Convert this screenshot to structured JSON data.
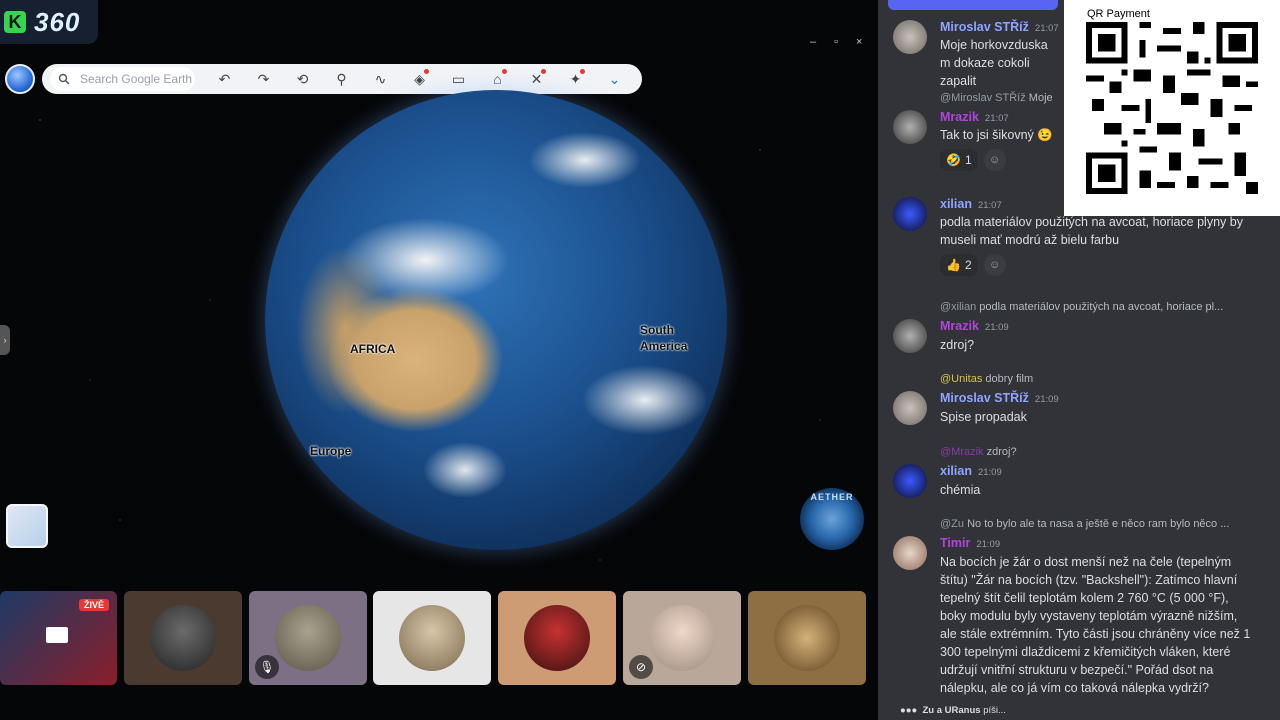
{
  "stream_logo": {
    "letter": "K",
    "number": "360"
  },
  "window_controls": [
    "–",
    "▫",
    "×"
  ],
  "earth": {
    "search_placeholder": "Search Google Earth",
    "labels": {
      "africa": "AFRICA",
      "south_america": "South\nAmerica",
      "europe": "Europe"
    },
    "aether_text": "AETHER"
  },
  "participants": [
    {
      "name": "live-screen",
      "badge": "ŽIVĚ"
    },
    {
      "name": "participant-2"
    },
    {
      "name": "participant-3",
      "muted": true
    },
    {
      "name": "participant-4"
    },
    {
      "name": "participant-5"
    },
    {
      "name": "participant-6",
      "muted": true
    },
    {
      "name": "participant-7"
    }
  ],
  "chat": {
    "banner": "…",
    "qr_label": "QR Payment",
    "messages": [
      {
        "user": "Miroslav STŘíž",
        "time": "21:07",
        "text": "Moje horkovzduska m dokaze cokoli zapalit",
        "user_color": "#8fa4ff"
      },
      {
        "reply_to": "@Miroslav STŘíž",
        "reply_text": "Moje",
        "user": "Mrazik",
        "time": "21:07",
        "text": "Tak to jsi šikovný 😉",
        "user_color": "#b245d9",
        "reactions": [
          {
            "emoji": "🤣",
            "count": "1"
          }
        ]
      },
      {
        "user": "xilian",
        "time": "21:07",
        "text": "podla materiálov použitých na avcoat, horiace plyny by museli mať modrú až bielu farbu",
        "user_color": "#8fa4ff",
        "reactions": [
          {
            "emoji": "👍",
            "count": "2"
          }
        ]
      },
      {
        "reply_to": "@xilian",
        "reply_text": "podla materiálov použitých na avcoat, horiace pl...",
        "user": "Mrazik",
        "time": "21:09",
        "text": "zdroj?",
        "user_color": "#b245d9"
      },
      {
        "reply_to": "@Unitas",
        "reply_text": "dobry film",
        "user": "Miroslav STŘíž",
        "time": "21:09",
        "text": "Spise propadak",
        "user_color": "#8fa4ff"
      },
      {
        "reply_to": "@Mrazik",
        "reply_text": "zdroj?",
        "user": "xilian",
        "time": "21:09",
        "text": "chémia",
        "user_color": "#8fa4ff"
      },
      {
        "reply_to": "@Zu",
        "reply_text": "No to bylo ale ta nasa a ještě e něco ram bylo něco ...",
        "user": "Timir",
        "time": "21:09",
        "text": "Na bocích je žár o dost menší než na čele (tepelným štítu) \"Žár na bocích (tzv. \"Backshell\"): Zatímco hlavní tepelný štít čelil teplotám kolem 2 760 °C (5 000 °F), boky modulu byly vystaveny teplotám výrazně nižším, ale stále extrémním. Tyto části jsou chráněny více než 1 300 tepelnými dlaždicemi z křemičitých vláken, které udržují vnitřní strukturu v bezpečí.\" Pořád dsot na nálepku, ale co já vím co taková nálepka vydrží?",
        "user_color": "#b245d9"
      }
    ],
    "typing": {
      "names": "Zu a URanus",
      "suffix": " píši..."
    }
  }
}
